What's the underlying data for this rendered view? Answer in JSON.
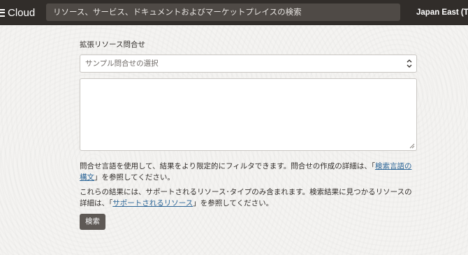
{
  "header": {
    "brand": "Cloud",
    "search_placeholder": "リソース、サービス、ドキュメントおよびマーケットプレイスの検索",
    "region": "Japan East (To"
  },
  "form": {
    "query_label": "拡張リソース問合せ",
    "sample_select_value": "サンプル問合せの選択",
    "help1_before": "問合せ言語を使用して、結果をより限定的にフィルタできます。問合せの作成の詳細は、「",
    "help1_link": "検索言語の構文",
    "help1_after": "」を参照してください。",
    "help2_before": "これらの結果には、サポートされるリソース･タイプのみ含まれます。検索結果に見つかるリソースの詳細は、「",
    "help2_link": "サポートされるリソース",
    "help2_after": "」を参照してください。",
    "search_button": "検索"
  },
  "icons": {
    "menu": "hamburger-icon",
    "select_chevron": "up-down-chevron-icon",
    "resize": "resize-grip-icon"
  },
  "colors": {
    "header_bg": "#312d2a",
    "link": "#2a6496",
    "button_bg": "#5e5955"
  }
}
